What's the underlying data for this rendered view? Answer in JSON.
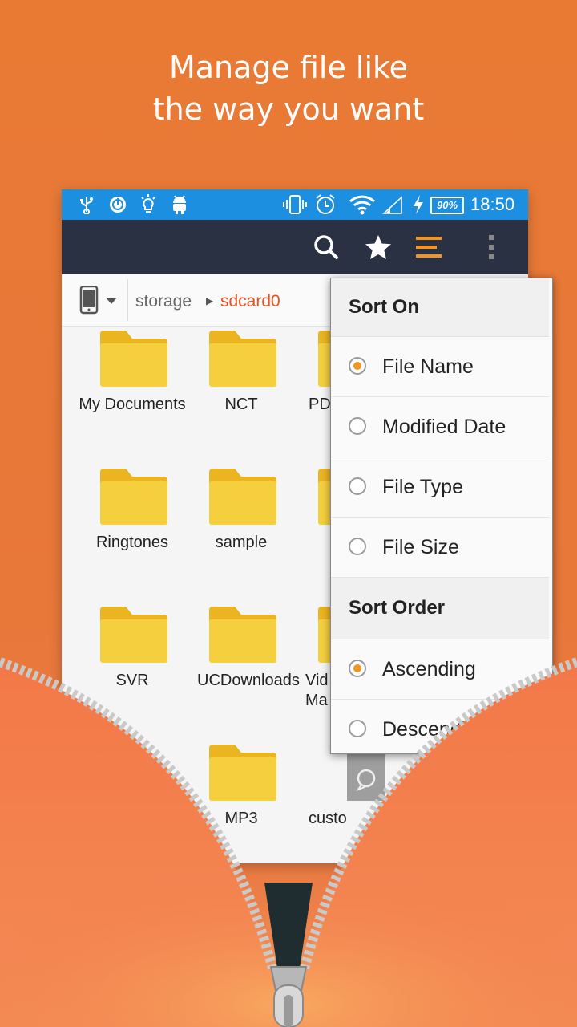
{
  "headline": {
    "line1": "Manage file like",
    "line2": "the way you want"
  },
  "status_bar": {
    "icons": [
      "usb-icon",
      "power-icon",
      "bulb-icon",
      "android-icon",
      "vibrate-icon",
      "alarm-icon",
      "wifi-icon",
      "signal-icon",
      "charging-icon"
    ],
    "battery": "90%",
    "time": "18:50"
  },
  "toolbar": {
    "icons": [
      "search-icon",
      "star-icon",
      "sort-icon",
      "overflow-menu-icon"
    ]
  },
  "path": {
    "storage": "storage",
    "current": "sdcard0"
  },
  "folders": [
    {
      "label": "My Documents"
    },
    {
      "label": "NCT"
    },
    {
      "label": "PD"
    },
    {
      "label": "Ringtones"
    },
    {
      "label": "sample"
    },
    {
      "label": "SVR"
    },
    {
      "label": "UCDownloads"
    },
    {
      "label": "Vid Ma"
    },
    {
      "label": "MP3"
    },
    {
      "label": "custo"
    }
  ],
  "sort_menu": {
    "sort_on_title": "Sort On",
    "sort_on_options": [
      {
        "label": "File Name",
        "selected": true
      },
      {
        "label": "Modified Date",
        "selected": false
      },
      {
        "label": "File Type",
        "selected": false
      },
      {
        "label": "File Size",
        "selected": false
      }
    ],
    "sort_order_title": "Sort Order",
    "sort_order_options": [
      {
        "label": "Ascending",
        "selected": true
      },
      {
        "label": "Descending",
        "selected": false
      }
    ]
  },
  "colors": {
    "background": "#e97a34",
    "status_bar": "#1d8fe0",
    "toolbar": "#2a3142",
    "accent": "#f39423",
    "path_active": "#e8501f",
    "folder": "#f5cf3e"
  }
}
